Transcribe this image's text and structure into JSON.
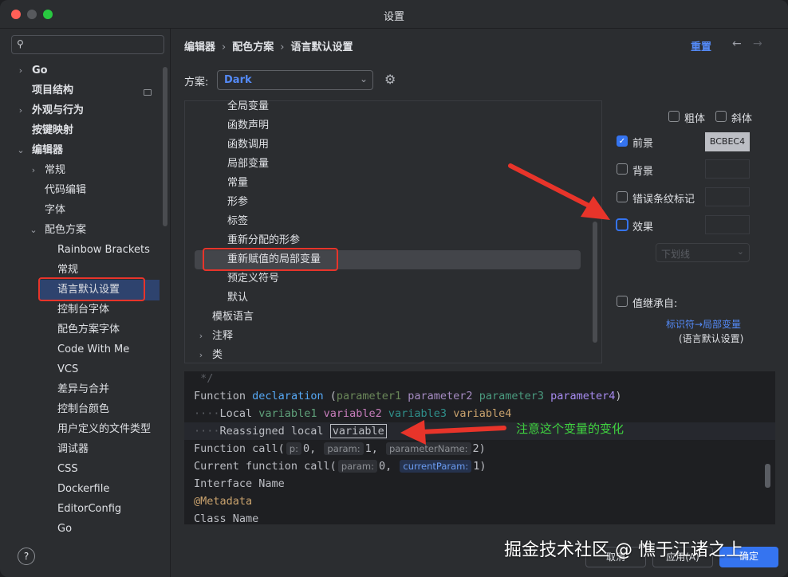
{
  "window": {
    "title": "设置"
  },
  "sidebar": {
    "search_placeholder": "",
    "items": [
      {
        "label": "Go"
      },
      {
        "label": "项目结构"
      },
      {
        "label": "外观与行为"
      },
      {
        "label": "按键映射"
      },
      {
        "label": "编辑器"
      },
      {
        "label": "常规"
      },
      {
        "label": "代码编辑"
      },
      {
        "label": "字体"
      },
      {
        "label": "配色方案"
      },
      {
        "label": "Rainbow Brackets"
      },
      {
        "label": "常规"
      },
      {
        "label": "语言默认设置"
      },
      {
        "label": "控制台字体"
      },
      {
        "label": "配色方案字体"
      },
      {
        "label": "Code With Me"
      },
      {
        "label": "VCS"
      },
      {
        "label": "差异与合并"
      },
      {
        "label": "控制台颜色"
      },
      {
        "label": "用户定义的文件类型"
      },
      {
        "label": "调试器"
      },
      {
        "label": "CSS"
      },
      {
        "label": "Dockerfile"
      },
      {
        "label": "EditorConfig"
      },
      {
        "label": "Go"
      }
    ],
    "help_label": "?"
  },
  "header": {
    "breadcrumb": [
      "编辑器",
      "配色方案",
      "语言默认设置"
    ],
    "breadcrumb_sep": "›",
    "reset_label": "重置",
    "back_icon": "←",
    "forward_icon": "→"
  },
  "scheme": {
    "label": "方案:",
    "value": "Dark"
  },
  "element_tree": {
    "items": [
      {
        "label": "全局变量"
      },
      {
        "label": "函数声明"
      },
      {
        "label": "函数调用"
      },
      {
        "label": "局部变量"
      },
      {
        "label": "常量"
      },
      {
        "label": "形参"
      },
      {
        "label": "标签"
      },
      {
        "label": "重新分配的形参"
      },
      {
        "label": "重新赋值的局部变量"
      },
      {
        "label": "预定义符号"
      },
      {
        "label": "默认"
      },
      {
        "label": "模板语言"
      },
      {
        "label": "注释"
      },
      {
        "label": "类"
      }
    ]
  },
  "options": {
    "bold_label": "粗体",
    "italic_label": "斜体",
    "foreground_label": "前景",
    "foreground_value": "BCBEC4",
    "background_label": "背景",
    "error_stripe_label": "错误条纹标记",
    "effects_label": "效果",
    "effect_type": "下划线",
    "inherit_label": "值继承自:",
    "inherit_link": "标识符→局部变量",
    "inherit_sub": "(语言默认设置)"
  },
  "preview": {
    "line0": " */",
    "l1_kw": "Function",
    "l1_fn": "declaration",
    "l1_p1": "parameter1",
    "l1_p2": "parameter2",
    "l1_p3": "parameter3",
    "l1_p4": "parameter4",
    "l2_ws": "····",
    "l2_kw": "Local",
    "l2_v1": "variable1",
    "l2_v2": "variable2",
    "l2_v3": "variable3",
    "l2_v4": "variable4",
    "l3_kw": "Reassigned local",
    "l3_var": "variable",
    "l4_kw": "Function call(",
    "l4_h1": "p:",
    "l4_v1": "0,",
    "l4_h2": "param:",
    "l4_v2": "1,",
    "l4_h3": "parameterName:",
    "l4_v3": "2)",
    "l5_kw": "Current function call(",
    "l5_h1": "param:",
    "l5_v1": "0,",
    "l5_h2": "currentParam:",
    "l5_v2": "1)",
    "line6": "Interface Name",
    "line7": "@Metadata",
    "line8": "Class Name"
  },
  "annotation_note": "注意这个变量的变化",
  "buttons": {
    "cancel": "取消",
    "apply": "应用(A)",
    "ok": "确定"
  },
  "watermark": "掘金技术社区 @ 憔于江诸之上",
  "colors": {
    "accent": "#3574f0",
    "link": "#548af7",
    "highlight_box": "#e8342a",
    "note": "#3fd23f"
  }
}
